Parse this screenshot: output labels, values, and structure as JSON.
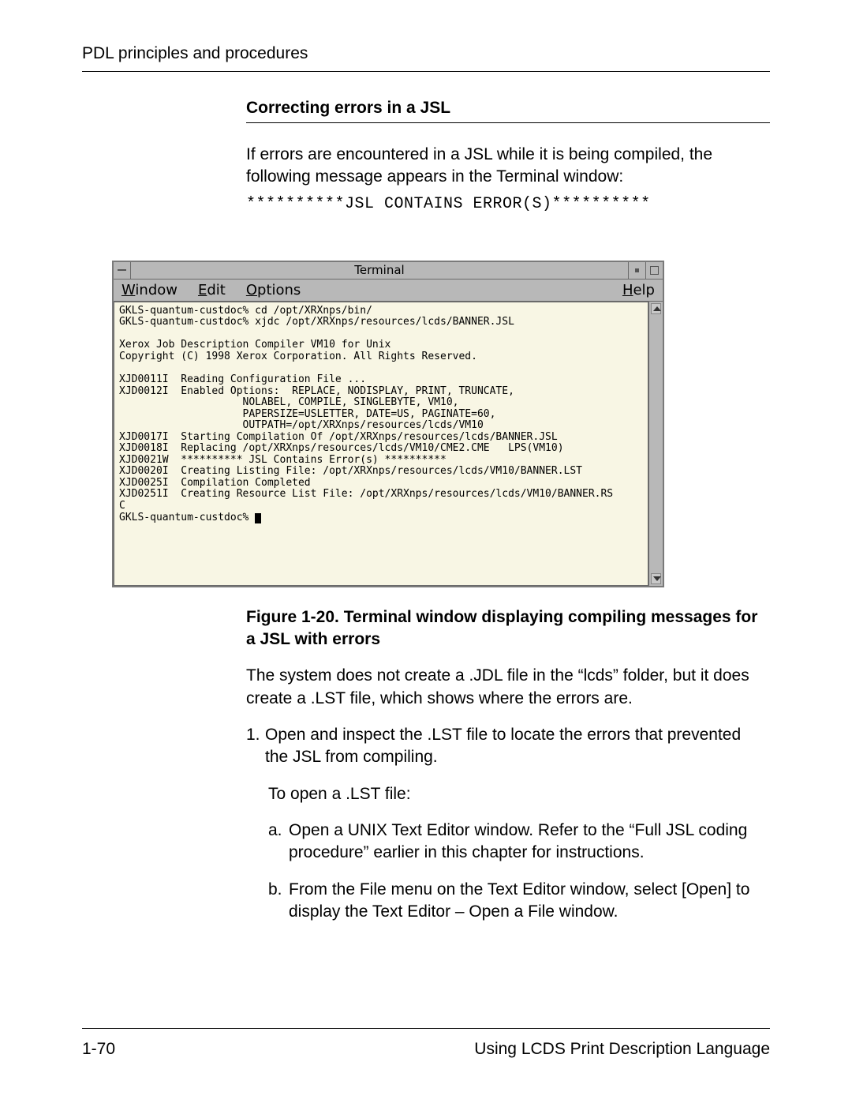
{
  "header": {
    "running": "PDL principles and procedures"
  },
  "section": {
    "title": "Correcting errors in a JSL"
  },
  "intro": {
    "p1": "If errors are encountered in a JSL while it is being compiled, the following message appears in the Terminal window:",
    "msg": "**********JSL CONTAINS ERROR(S)**********"
  },
  "terminal": {
    "title": "Terminal",
    "menus": {
      "window": "Window",
      "edit": "Edit",
      "options": "Options",
      "help": "Help"
    },
    "lines": [
      "GKLS-quantum-custdoc% cd /opt/XRXnps/bin/",
      "GKLS-quantum-custdoc% xjdc /opt/XRXnps/resources/lcds/BANNER.JSL",
      "",
      "Xerox Job Description Compiler VM10 for Unix",
      "Copyright (C) 1998 Xerox Corporation. All Rights Reserved.",
      "",
      "XJD0011I  Reading Configuration File ...",
      "XJD0012I  Enabled Options:  REPLACE, NODISPLAY, PRINT, TRUNCATE,",
      "                    NOLABEL, COMPILE, SINGLEBYTE, VM10,",
      "                    PAPERSIZE=USLETTER, DATE=US, PAGINATE=60,",
      "                    OUTPATH=/opt/XRXnps/resources/lcds/VM10",
      "XJD0017I  Starting Compilation Of /opt/XRXnps/resources/lcds/BANNER.JSL",
      "XJD0018I  Replacing /opt/XRXnps/resources/lcds/VM10/CME2.CME   LPS(VM10)",
      "XJD0021W  ********** JSL Contains Error(s) **********",
      "XJD0020I  Creating Listing File: /opt/XRXnps/resources/lcds/VM10/BANNER.LST",
      "XJD0025I  Compilation Completed",
      "XJD0251I  Creating Resource List File: /opt/XRXnps/resources/lcds/VM10/BANNER.RS",
      "C",
      "GKLS-quantum-custdoc% "
    ]
  },
  "figure": {
    "caption": "Figure 1-20. Terminal window displaying compiling messages for a JSL with errors"
  },
  "post": {
    "p1": "The system does not create a .JDL file in the “lcds” folder, but it does create a .LST file, which shows where the errors are.",
    "step1_num": "1.",
    "step1": "Open and inspect the .LST file to locate the errors that prevented the JSL from compiling.",
    "sub1": "To open a .LST file:",
    "a_letter": "a.",
    "a": "Open a UNIX Text Editor window. Refer to the “Full JSL coding procedure” earlier in this chapter for instructions.",
    "b_letter": "b.",
    "b": "From the File menu on the Text Editor window, select [Open] to display the Text Editor – Open a File window."
  },
  "footer": {
    "page": "1-70",
    "doc": "Using LCDS Print Description Language"
  }
}
